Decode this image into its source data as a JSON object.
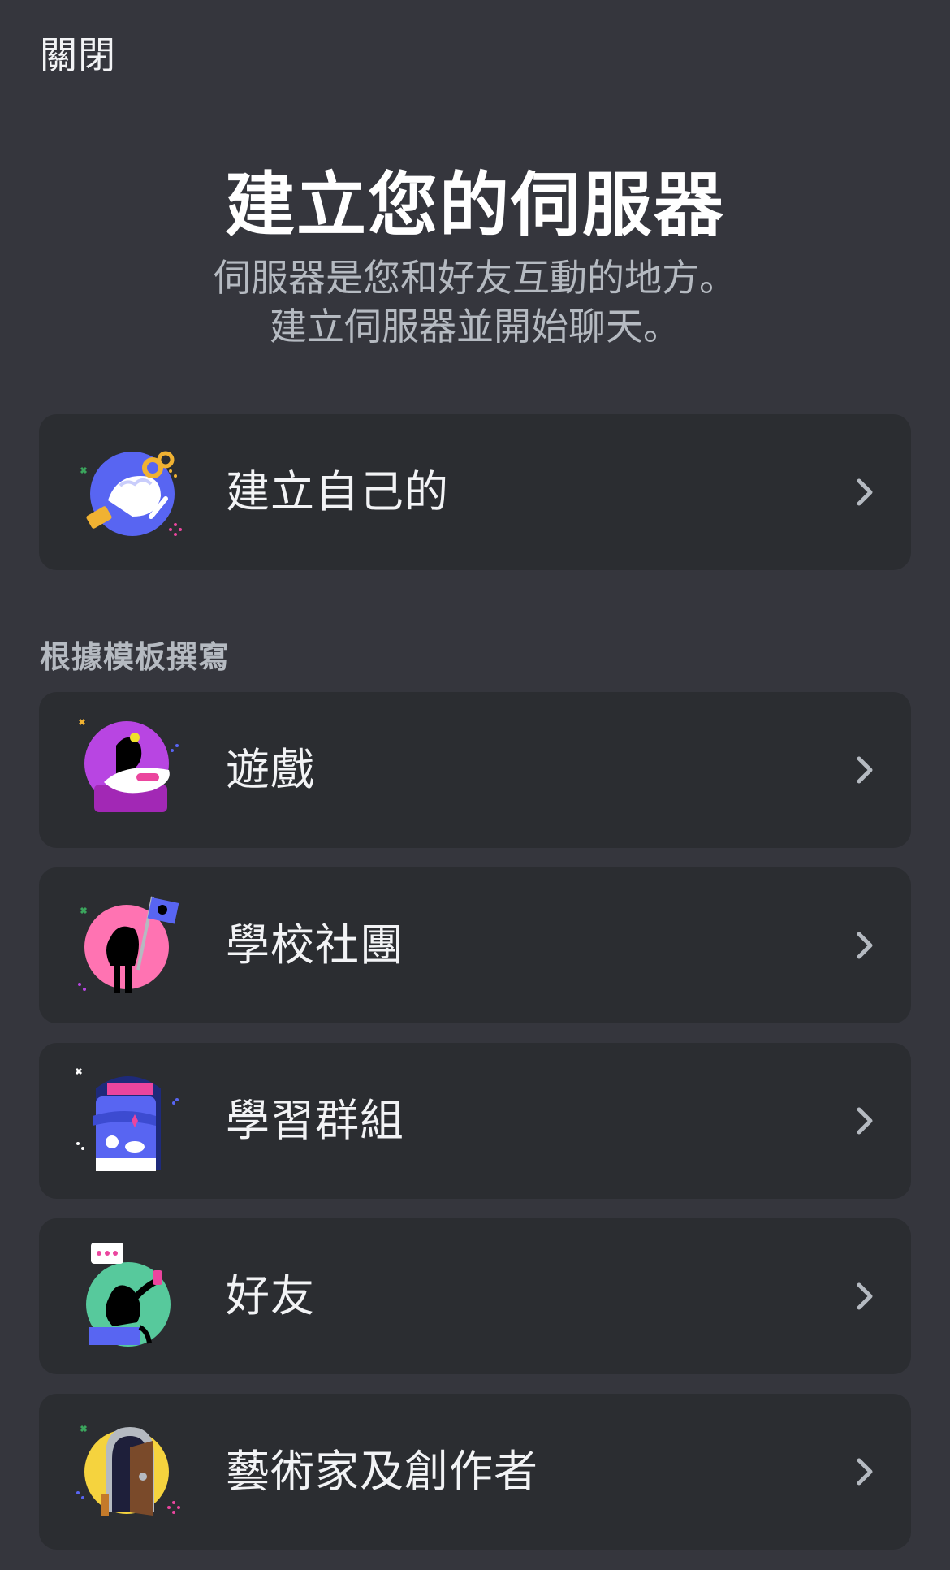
{
  "header": {
    "close_label": "關閉"
  },
  "main": {
    "title": "建立您的伺服器",
    "subtitle_line1": "伺服器是您和好友互動的地方。",
    "subtitle_line2": "建立伺服器並開始聊天。"
  },
  "create_own": {
    "label": "建立自己的",
    "icon": "create-server-illustration-icon"
  },
  "templates": {
    "section_title": "根據模板撰寫",
    "items": [
      {
        "label": "遊戲",
        "icon": "gaming-illustration-icon"
      },
      {
        "label": "學校社團",
        "icon": "school-club-illustration-icon"
      },
      {
        "label": "學習群組",
        "icon": "study-group-illustration-icon"
      },
      {
        "label": "好友",
        "icon": "friends-illustration-icon"
      },
      {
        "label": "藝術家及創作者",
        "icon": "artists-creators-illustration-icon"
      }
    ]
  },
  "colors": {
    "background": "#35363d",
    "card": "#2b2d31",
    "text_primary": "#f2f3f5",
    "text_muted": "#b5bac1",
    "chevron": "#b5bac1"
  }
}
